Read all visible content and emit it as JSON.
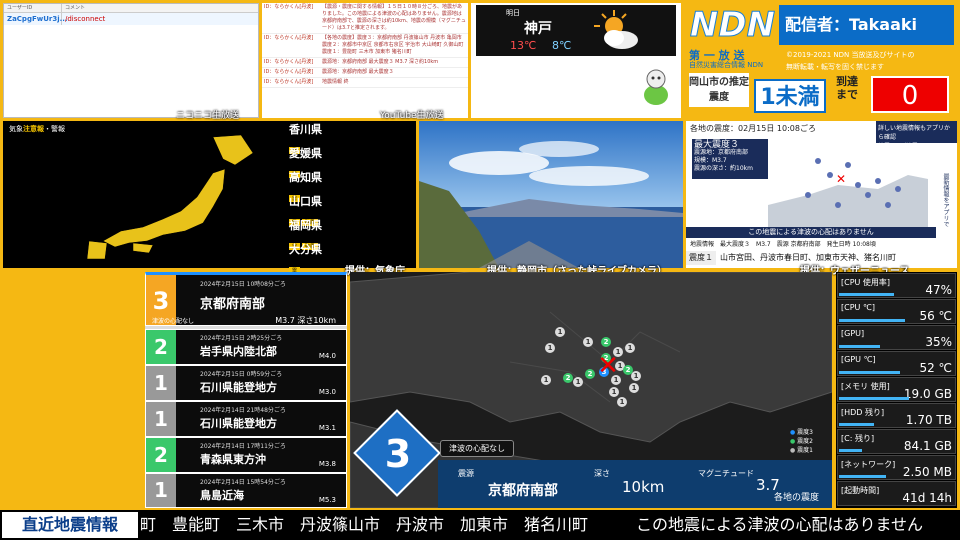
{
  "chat": {
    "col_user": "ユーザーID",
    "col_comment": "コメント",
    "rows": [
      {
        "user": "ZaCpgFwUr3j...",
        "comment": "/disconnect"
      }
    ]
  },
  "comments": [
    {
      "user": "ID：ならかくん[丹波]",
      "text": "【震源・震度に関する情報】１５日１０時８分ごろ、地震がありました。この地震による津波の心配はありません。震源地は京都府南部で、震源の深さは約10km、地震の規模（マグニチュード）は3.7と推定されます。"
    },
    {
      "user": "ID：ならかくん[丹波]",
      "text": "【各地の震度】震度３：京都府南部 丹波篠山市 丹波市 亀岡市 震度２：京都市中京区 京都市右京区 宇治市 大山崎町 久御山町 震度１：豊能町 三木市 加東市 猪名川町"
    },
    {
      "user": "ID：ならかくん[丹波]",
      "text": "震源地：京都府南部 最大震度３ M3.7 深さ約10km"
    },
    {
      "user": "ID：ならかくん[丹波]",
      "text": "震源地：京都府南部 最大震度３"
    },
    {
      "user": "ID：ならかくん[丹波]",
      "text": "地震情報 終"
    }
  ],
  "weather": {
    "label": "明日",
    "city": "神戸",
    "high": "13℃",
    "low": "8℃"
  },
  "ndn": {
    "logo": "NDN",
    "caster": "配信者：Takaaki",
    "broadcast": "第 一 放 送",
    "broadcast_sub": "自然災害総合情報 NDN",
    "copyright_1": "©2019-2021 NDN 当放送及びサイトの",
    "copyright_2": "無断転載・転写を固く禁じます",
    "okayama_label": "岡山市の推定震度",
    "okayama_value": "1未満",
    "arrival_label": "到達まで",
    "arrival_value": "0"
  },
  "japan_map": {
    "title_prefix": "気象",
    "title_highlight": "注意報",
    "title_suffix": "・警報",
    "credit": "提供：気象庁",
    "overlay": "ニコニコ生放送",
    "prefs": [
      {
        "name": "香川県",
        "tags": [
          "雷"
        ]
      },
      {
        "name": "愛媛県",
        "tags": [
          "雷"
        ]
      },
      {
        "name": "高知県",
        "tags": [
          "雷"
        ]
      },
      {
        "name": "山口県",
        "tags": [
          "雷",
          "強風"
        ]
      },
      {
        "name": "福岡県",
        "tags": [
          "雷",
          "強風"
        ]
      },
      {
        "name": "大分県",
        "tags": [
          "雷"
        ]
      }
    ]
  },
  "live_cam": {
    "overlay": "YouTube生放送",
    "credit": "提供：静岡市（さった峠ライブカメラ）"
  },
  "news": {
    "header": "各地の震度：02月15日 10:08ごろ",
    "banner": "詳しい地震情報もアプリから確認",
    "banner_sub": "地震Ch.／地震アラーム",
    "max_label": "最大震度３",
    "epicenter": "震源地：京都府南部",
    "mag": "規模：M3.7",
    "depth": "震源の深さ：約10km",
    "tsunami": "この地震による津波の心配はありません",
    "bar_label": "地震情報",
    "bar_max": "最大震度３",
    "bar_mag": "M3.7",
    "bar_epi": "震源 京都府南部",
    "bar_time": "発生日時 10:08頃",
    "scroll_label": "震度１",
    "scroll_text": "山市宮田、丹波市春日町、加東市天神、猪名川町",
    "credit": "提供：ウェザーニュース",
    "side": "最新情報をアプリで"
  },
  "eq_list": [
    {
      "int": "3",
      "dt": "2024年2月15日 10時08分ごろ",
      "place": "京都府南部",
      "note": "津波の心配なし",
      "mag": "M3.7 深さ10km",
      "color": "#f5a623"
    },
    {
      "int": "2",
      "dt": "2024年2月15日 2時25分ごろ",
      "place": "岩手県内陸北部",
      "mag": "M4.0",
      "color": "#3ac86b"
    },
    {
      "int": "1",
      "dt": "2024年2月15日 0時59分ごろ",
      "place": "石川県能登地方",
      "mag": "M3.0",
      "color": "#999"
    },
    {
      "int": "1",
      "dt": "2024年2月14日 21時48分ごろ",
      "place": "石川県能登地方",
      "mag": "M3.1",
      "color": "#999"
    },
    {
      "int": "2",
      "dt": "2024年2月14日 17時11分ごろ",
      "place": "青森県東方沖",
      "mag": "M3.8",
      "color": "#3ac86b"
    },
    {
      "int": "1",
      "dt": "2024年2月14日 15時54分ごろ",
      "place": "鳥島近海",
      "mag": "M5.3",
      "color": "#999"
    }
  ],
  "quake_map": {
    "intensity": "3",
    "tsunami": "津波の心配なし",
    "legend": [
      "震度3",
      "震度2",
      "震度1"
    ],
    "epi_label": "震源",
    "epi": "京都府南部",
    "depth_label": "深さ",
    "depth": "10km",
    "mag_label": "マグニチュード",
    "mag": "3.7",
    "caption": "各地の震度"
  },
  "system": [
    {
      "label": "[CPU 使用率]",
      "value": "47%",
      "fill": 0.47
    },
    {
      "label": "[CPU ℃]",
      "value": "56 ℃",
      "fill": 0.56
    },
    {
      "label": "[GPU]",
      "value": "35%",
      "fill": 0.35
    },
    {
      "label": "[GPU ℃]",
      "value": "52 ℃",
      "fill": 0.52
    },
    {
      "label": "[メモリ 使用]",
      "value": "19.0 GB",
      "fill": 0.6
    },
    {
      "label": "[HDD 残り]",
      "value": "1.70 TB",
      "fill": 0.3
    },
    {
      "label": "[C: 残り]",
      "value": "84.1 GB",
      "fill": 0.2
    },
    {
      "label": "[ネットワーク]",
      "value": "2.50 MB",
      "fill": 0.4
    },
    {
      "label": "[起動時間]",
      "value": "41d 14h",
      "fill": 0.0
    }
  ],
  "ticker": {
    "label": "直近地震情報",
    "text": "町　豊能町　三木市　丹波篠山市　丹波市　加東市　猪名川町　　　この地震による津波の心配はありません"
  },
  "colors": {
    "bg": "#f5b813",
    "blue": "#0b6cc7",
    "red": "#e00000",
    "int3": "#f5a623",
    "int2": "#3ac86b",
    "int1": "#999999"
  }
}
